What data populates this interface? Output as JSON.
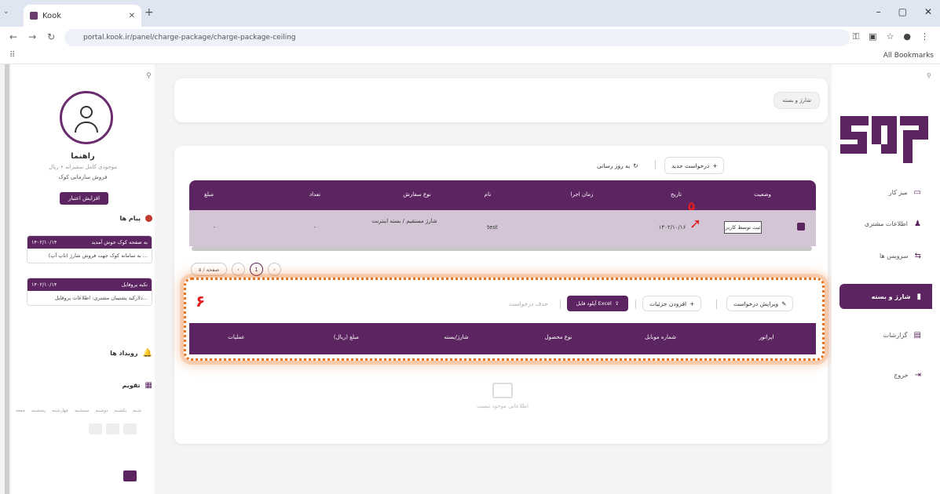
{
  "browser": {
    "tab_title": "Kook",
    "url": "portal.kook.ir/panel/charge-package/charge-package-ceiling",
    "bookmarks_label": "All Bookmarks"
  },
  "left_panel": {
    "user_name": "راهنما",
    "user_subtitle": "موجودی کامل سفیرانه • ریال",
    "shop_link": "فروش سازمانی کوک",
    "credit_button": "افزایش اعتبار",
    "messages_title": "پیام ها",
    "messages": [
      {
        "title": "به صفحه کوک خوش آمدید",
        "time": "۱۴۰۲/۱۰/۱۴",
        "body": "به سامانه کوک جهت فروش شارژ (تاپ آپ) ..."
      },
      {
        "title": "تکیه پروفایل",
        "time": "۱۴۰۲/۱۰/۱۴",
        "body": "دلارکید پشتیبان مشتری: اطلاعات پروفایل..."
      }
    ],
    "events_title": "رویداد ها",
    "calendar_title": "تقویم",
    "weekdays": [
      "شنبه",
      "یکشنبه",
      "دوشنبه",
      "سه‌شنبه",
      "چهارشنبه",
      "پنجشنبه",
      "جمعه"
    ]
  },
  "header": {
    "breadcrumb": "شارژ و بسته"
  },
  "toolbar": {
    "new_request": "درخواست جدید",
    "refresh": "به روز رسانی"
  },
  "table1": {
    "columns": [
      "وضعیت",
      "تاریخ",
      "زمان اجرا",
      "نام",
      "نوع سفارش",
      "تعداد",
      "مبلغ"
    ],
    "row": {
      "status": "ثبت توسط کاربر",
      "date": "۱۴۰۲/۱۰/۱۶",
      "run_time": "",
      "name": "test",
      "order_type": "شارژ مستقیم / بسته اینترنت",
      "count": "-",
      "amount": "-"
    }
  },
  "pager": {
    "page_size": "۵ / صفحه",
    "current": "1"
  },
  "annotations": {
    "first": "۵",
    "second": "۶"
  },
  "section2": {
    "edit_request": "ویرایش درخواست",
    "add_details": "افزودن جزئیات",
    "upload_excel": "آپلود فایل Excel",
    "delete_request": "حذف درخواست",
    "columns": [
      "اپراتور",
      "شماره موبایل",
      "نوع محصول",
      "شارژ/بسته",
      "مبلغ (ریال)",
      "عملیات"
    ],
    "empty_text": "اطلاعاتی موجود نیست"
  },
  "sidebar": {
    "items": [
      {
        "label": "میز کار",
        "icon": "dashboard-icon"
      },
      {
        "label": "اطلاعات مشتری",
        "icon": "user-icon"
      },
      {
        "label": "سرویس ها",
        "icon": "services-icon"
      },
      {
        "label": "شارژ و بسته",
        "icon": "sim-icon",
        "active": true
      },
      {
        "label": "گزارشات",
        "icon": "chart-icon"
      },
      {
        "label": "خروج",
        "icon": "logout-icon"
      }
    ]
  },
  "colors": {
    "primary": "#5c2460",
    "row": "#d3c5d5",
    "highlight": "#e8711a",
    "annotation": "#e02020"
  }
}
